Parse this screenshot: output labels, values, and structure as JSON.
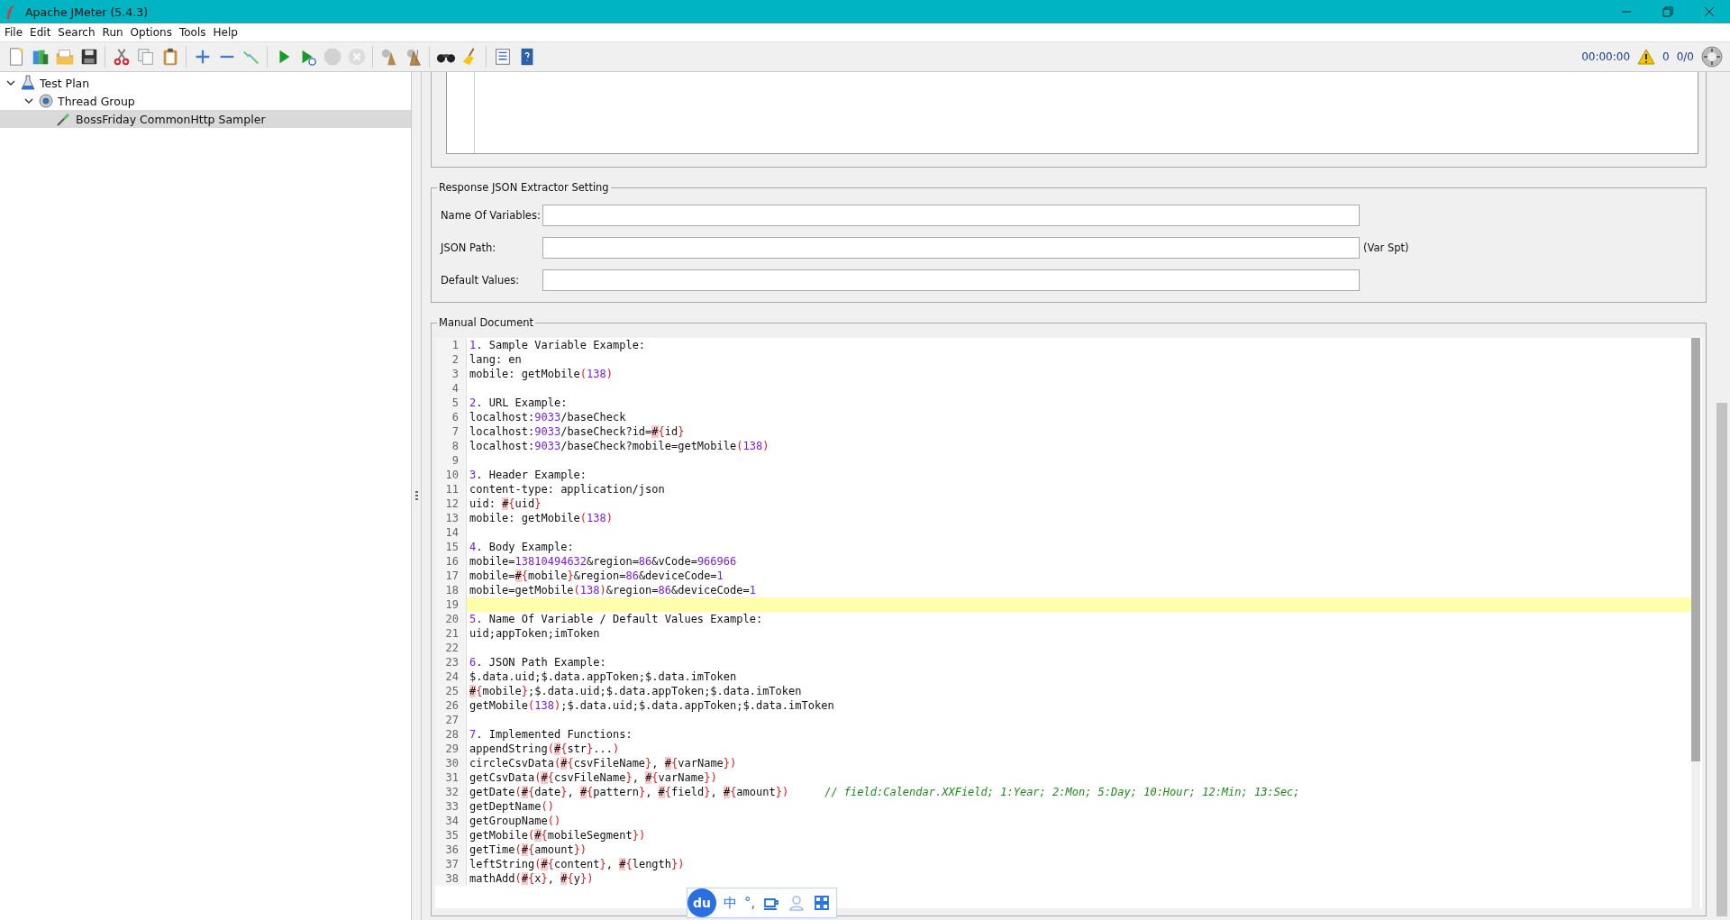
{
  "window": {
    "title": "Apache JMeter (5.4.3)"
  },
  "menu": [
    "File",
    "Edit",
    "Search",
    "Run",
    "Options",
    "Tools",
    "Help"
  ],
  "toolbar": [
    [
      {
        "kind": "new",
        "disabled": false
      },
      {
        "kind": "templates",
        "disabled": false
      },
      {
        "kind": "open",
        "disabled": false
      },
      {
        "kind": "save",
        "disabled": false
      }
    ],
    [
      {
        "kind": "cut",
        "disabled": false
      },
      {
        "kind": "copy",
        "disabled": false
      },
      {
        "kind": "paste",
        "disabled": false
      }
    ],
    [
      {
        "kind": "expand",
        "disabled": false
      },
      {
        "kind": "collapse",
        "disabled": false
      },
      {
        "kind": "toggle",
        "disabled": false
      }
    ],
    [
      {
        "kind": "start",
        "disabled": false
      },
      {
        "kind": "start-no-timers",
        "disabled": false
      },
      {
        "kind": "stop",
        "disabled": true
      },
      {
        "kind": "shutdown",
        "disabled": true
      }
    ],
    [
      {
        "kind": "clear",
        "disabled": false
      },
      {
        "kind": "clear-all",
        "disabled": false
      }
    ],
    [
      {
        "kind": "search",
        "disabled": false
      },
      {
        "kind": "reset-search",
        "disabled": false
      }
    ],
    [
      {
        "kind": "function-helper",
        "disabled": false
      },
      {
        "kind": "help",
        "disabled": false
      }
    ]
  ],
  "status": {
    "timer": "00:00:00",
    "warnings": "0",
    "threads": "0/0"
  },
  "tree": [
    {
      "label": "Test Plan",
      "kind": "plan",
      "expanded": true,
      "selected": false,
      "children": [
        {
          "label": "Thread Group",
          "kind": "group",
          "expanded": true,
          "selected": false,
          "children": [
            {
              "label": "BossFriday CommonHttp Sampler",
              "kind": "sampler",
              "selected": true
            }
          ]
        }
      ]
    }
  ],
  "extractor": {
    "title": "Response JSON Extractor Setting",
    "fields": [
      {
        "label": "Name Of Variables:"
      },
      {
        "label": "JSON Path:",
        "hint": "(Var Spt)"
      },
      {
        "label": "Default Values:"
      }
    ]
  },
  "manual": {
    "title": "Manual Document",
    "lines": [
      {
        "n": "1",
        "text": "1. Sample Variable Example:",
        "current": false
      },
      {
        "n": "2",
        "text": "lang: en",
        "current": false
      },
      {
        "n": "3",
        "text": "mobile: getMobile(138)",
        "current": false
      },
      {
        "n": "4",
        "current": false
      },
      {
        "n": "5",
        "text": "2. URL Example:",
        "current": false
      },
      {
        "n": "6",
        "text": "localhost:9033/baseCheck",
        "current": false
      },
      {
        "n": "7",
        "text": "localhost:9033/baseCheck?id=#{id}",
        "current": false
      },
      {
        "n": "8",
        "text": "localhost:9033/baseCheck?mobile=getMobile(138)",
        "current": false
      },
      {
        "n": "9",
        "current": false
      },
      {
        "n": "10",
        "text": "3. Header Example:",
        "current": false
      },
      {
        "n": "11",
        "text": "content-type: application/json",
        "current": false
      },
      {
        "n": "12",
        "text": "uid: #{uid}",
        "current": false
      },
      {
        "n": "13",
        "text": "mobile: getMobile(138)",
        "current": false
      },
      {
        "n": "14",
        "current": false
      },
      {
        "n": "15",
        "text": "4. Body Example:",
        "current": false
      },
      {
        "n": "16",
        "text": "mobile=13810494632&region=86&vCode=966966",
        "current": false
      },
      {
        "n": "17",
        "text": "mobile=#{mobile}&region=86&deviceCode=1",
        "current": false
      },
      {
        "n": "18",
        "text": "mobile=getMobile(138)&region=86&deviceCode=1",
        "current": false
      },
      {
        "n": "19",
        "current": true
      },
      {
        "n": "20",
        "text": "5. Name Of Variable / Default Values Example:",
        "current": false
      },
      {
        "n": "21",
        "text": "uid;appToken;imToken",
        "current": false
      },
      {
        "n": "22",
        "current": false
      },
      {
        "n": "23",
        "text": "6. JSON Path Example:",
        "current": false
      },
      {
        "n": "24",
        "text": "$.data.uid;$.data.appToken;$.data.imToken",
        "current": false
      },
      {
        "n": "25",
        "text": "#{mobile};$.data.uid;$.data.appToken;$.data.imToken",
        "current": false
      },
      {
        "n": "26",
        "text": "getMobile(138);$.data.uid;$.data.appToken;$.data.imToken",
        "current": false
      },
      {
        "n": "27",
        "current": false
      },
      {
        "n": "28",
        "text": "7. Implemented Functions:",
        "current": false
      },
      {
        "n": "29",
        "text": "appendString(#{str}...)",
        "current": false
      },
      {
        "n": "30",
        "text": "circleCsvData(#{csvFileName}, #{varName})",
        "current": false
      },
      {
        "n": "31",
        "text": "getCsvData(#{csvFileName}, #{varName})",
        "current": false
      },
      {
        "n": "32",
        "text": "getDate(#{date}, #{pattern}, #{field}, #{amount})",
        "comment": "// field:Calendar.XXField; 1:Year; 2:Mon; 5:Day; 10:Hour; 12:Min; 13:Sec;",
        "current": false
      },
      {
        "n": "33",
        "text": "getDeptName()",
        "current": false
      },
      {
        "n": "34",
        "text": "getGroupName()",
        "current": false
      },
      {
        "n": "35",
        "text": "getMobile(#{mobileSegment})",
        "current": false
      },
      {
        "n": "36",
        "text": "getTime(#{amount})",
        "current": false
      },
      {
        "n": "37",
        "text": "leftString(#{content}, #{length})",
        "current": false
      },
      {
        "n": "38",
        "text": "mathAdd(#{x}, #{y})",
        "current": false
      }
    ]
  },
  "ime_bar": {
    "logo": "du",
    "mode": "中",
    "punct": "°,"
  }
}
